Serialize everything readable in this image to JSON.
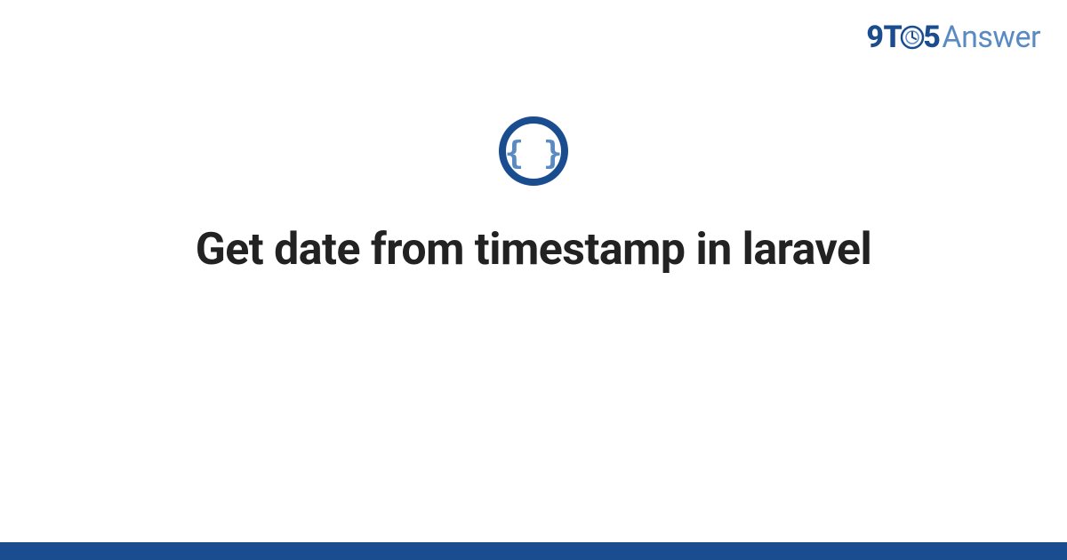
{
  "logo": {
    "nine": "9",
    "t": "T",
    "five": "5",
    "answer": "Answer"
  },
  "category_icon": {
    "name": "code-braces",
    "ring_color": "#1a4d8f",
    "brace_color": "#5a8ac2"
  },
  "title": "Get date from timestamp in laravel",
  "brand_color": "#1a4d8f",
  "accent_color": "#5a8ac2"
}
